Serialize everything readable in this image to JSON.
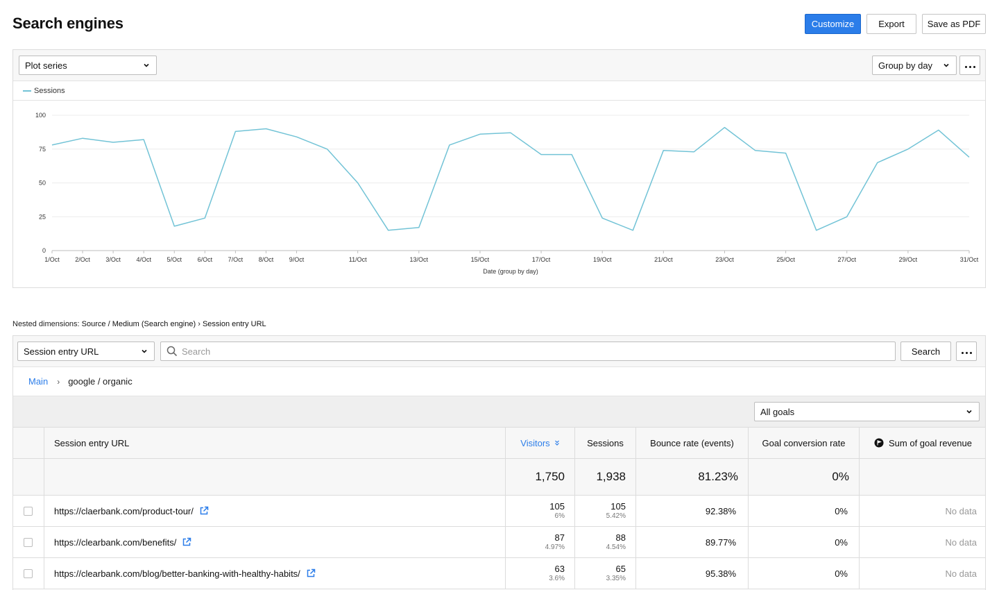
{
  "page": {
    "title": "Search engines"
  },
  "header": {
    "customize_label": "Customize",
    "export_label": "Export",
    "save_pdf_label": "Save as PDF",
    "accent": "#2b7de9"
  },
  "chart_toolbar": {
    "plot_series_label": "Plot series",
    "group_by_label": "Group by day"
  },
  "chart_data": {
    "type": "line",
    "x": [
      "1/Oct",
      "2/Oct",
      "3/Oct",
      "4/Oct",
      "5/Oct",
      "6/Oct",
      "7/Oct",
      "8/Oct",
      "9/Oct",
      "10/Oct",
      "11/Oct",
      "12/Oct",
      "13/Oct",
      "14/Oct",
      "15/Oct",
      "16/Oct",
      "17/Oct",
      "18/Oct",
      "19/Oct",
      "20/Oct",
      "21/Oct",
      "22/Oct",
      "23/Oct",
      "24/Oct",
      "25/Oct",
      "26/Oct",
      "27/Oct",
      "28/Oct",
      "29/Oct",
      "30/Oct",
      "31/Oct"
    ],
    "x_tick_labels": [
      "1/Oct",
      "2/Oct",
      "3/Oct",
      "4/Oct",
      "5/Oct",
      "6/Oct",
      "7/Oct",
      "8/Oct",
      "9/Oct",
      "11/Oct",
      "13/Oct",
      "15/Oct",
      "17/Oct",
      "19/Oct",
      "21/Oct",
      "23/Oct",
      "25/Oct",
      "27/Oct",
      "29/Oct",
      "31/Oct"
    ],
    "series": [
      {
        "name": "Sessions",
        "color": "#72c3d6",
        "values": [
          78,
          83,
          80,
          82,
          18,
          24,
          88,
          90,
          84,
          75,
          50,
          15,
          17,
          78,
          86,
          87,
          71,
          71,
          24,
          15,
          74,
          73,
          91,
          74,
          72,
          15,
          25,
          65,
          75,
          89,
          69
        ]
      }
    ],
    "ylim": [
      0,
      100
    ],
    "yticks": [
      0,
      25,
      50,
      75,
      100
    ],
    "xlabel": "Date (group by day)",
    "ylabel": "",
    "legend": "top-left",
    "grid": true
  },
  "nested": {
    "prefix": "Nested dimensions:",
    "path": "Source / Medium (Search engine)",
    "arrow": "›",
    "leaf": "Session entry URL"
  },
  "table_toolbar": {
    "dimension_label": "Session entry URL",
    "search_placeholder": "Search",
    "search_button": "Search"
  },
  "breadcrumb": {
    "root": "Main",
    "sep": "›",
    "current": "google / organic"
  },
  "goals": {
    "selected": "All goals"
  },
  "table": {
    "headers": {
      "url": "Session entry URL",
      "visitors": "Visitors",
      "sessions": "Sessions",
      "bounce": "Bounce rate (events)",
      "goal_conv": "Goal conversion rate",
      "goal_rev": "Sum of goal revenue"
    },
    "totals": {
      "visitors": "1,750",
      "sessions": "1,938",
      "bounce": "81.23%",
      "goal_conv": "0%"
    },
    "rows": [
      {
        "url": "https://claerbank.com/product-tour/",
        "visitors": "105",
        "visitors_pct": "6%",
        "sessions": "105",
        "sessions_pct": "5.42%",
        "bounce": "92.38%",
        "goal_conv": "0%",
        "goal_rev": "No data"
      },
      {
        "url": "https://clearbank.com/benefits/",
        "visitors": "87",
        "visitors_pct": "4.97%",
        "sessions": "88",
        "sessions_pct": "4.54%",
        "bounce": "89.77%",
        "goal_conv": "0%",
        "goal_rev": "No data"
      },
      {
        "url": "https://clearbank.com/blog/better-banking-with-healthy-habits/",
        "visitors": "63",
        "visitors_pct": "3.6%",
        "sessions": "65",
        "sessions_pct": "3.35%",
        "bounce": "95.38%",
        "goal_conv": "0%",
        "goal_rev": "No data"
      }
    ]
  }
}
